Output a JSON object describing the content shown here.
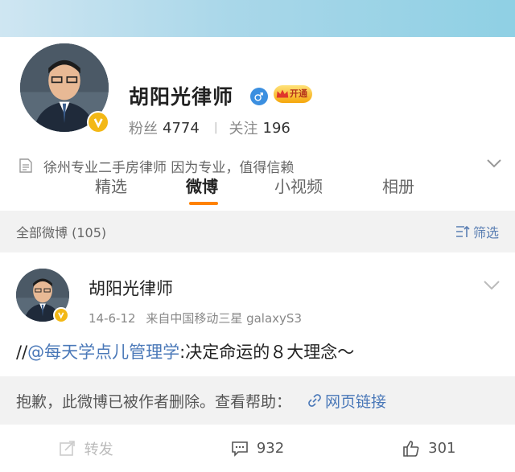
{
  "profile": {
    "name": "胡阳光律师",
    "vip_label": "开通",
    "fans_label": "粉丝",
    "fans_count": "4774",
    "follow_label": "关注",
    "follow_count": "196",
    "bio": "徐州专业二手房律师 因为专业，值得信赖",
    "gender": "male"
  },
  "tabs": [
    "精选",
    "微博",
    "小视频",
    "相册"
  ],
  "active_tab": "微博",
  "filter": {
    "label": "全部微博 (105)",
    "button": "筛选"
  },
  "post": {
    "author": "胡阳光律师",
    "date": "14-6-12",
    "source": "来自中国移动三星 galaxyS3",
    "text_prefix": "//",
    "mention": "@每天学点儿管理学",
    "text_suffix": ":决定命运的８大理念～",
    "deleted_notice": "抱歉，此微博已被作者删除。查看帮助：",
    "link_text": "网页链接",
    "repost_label": "转发",
    "comment_count": "932",
    "like_count": "301"
  },
  "colors": {
    "accent": "#ff8200",
    "link": "#4a78b8",
    "verified": "#f3b816"
  }
}
